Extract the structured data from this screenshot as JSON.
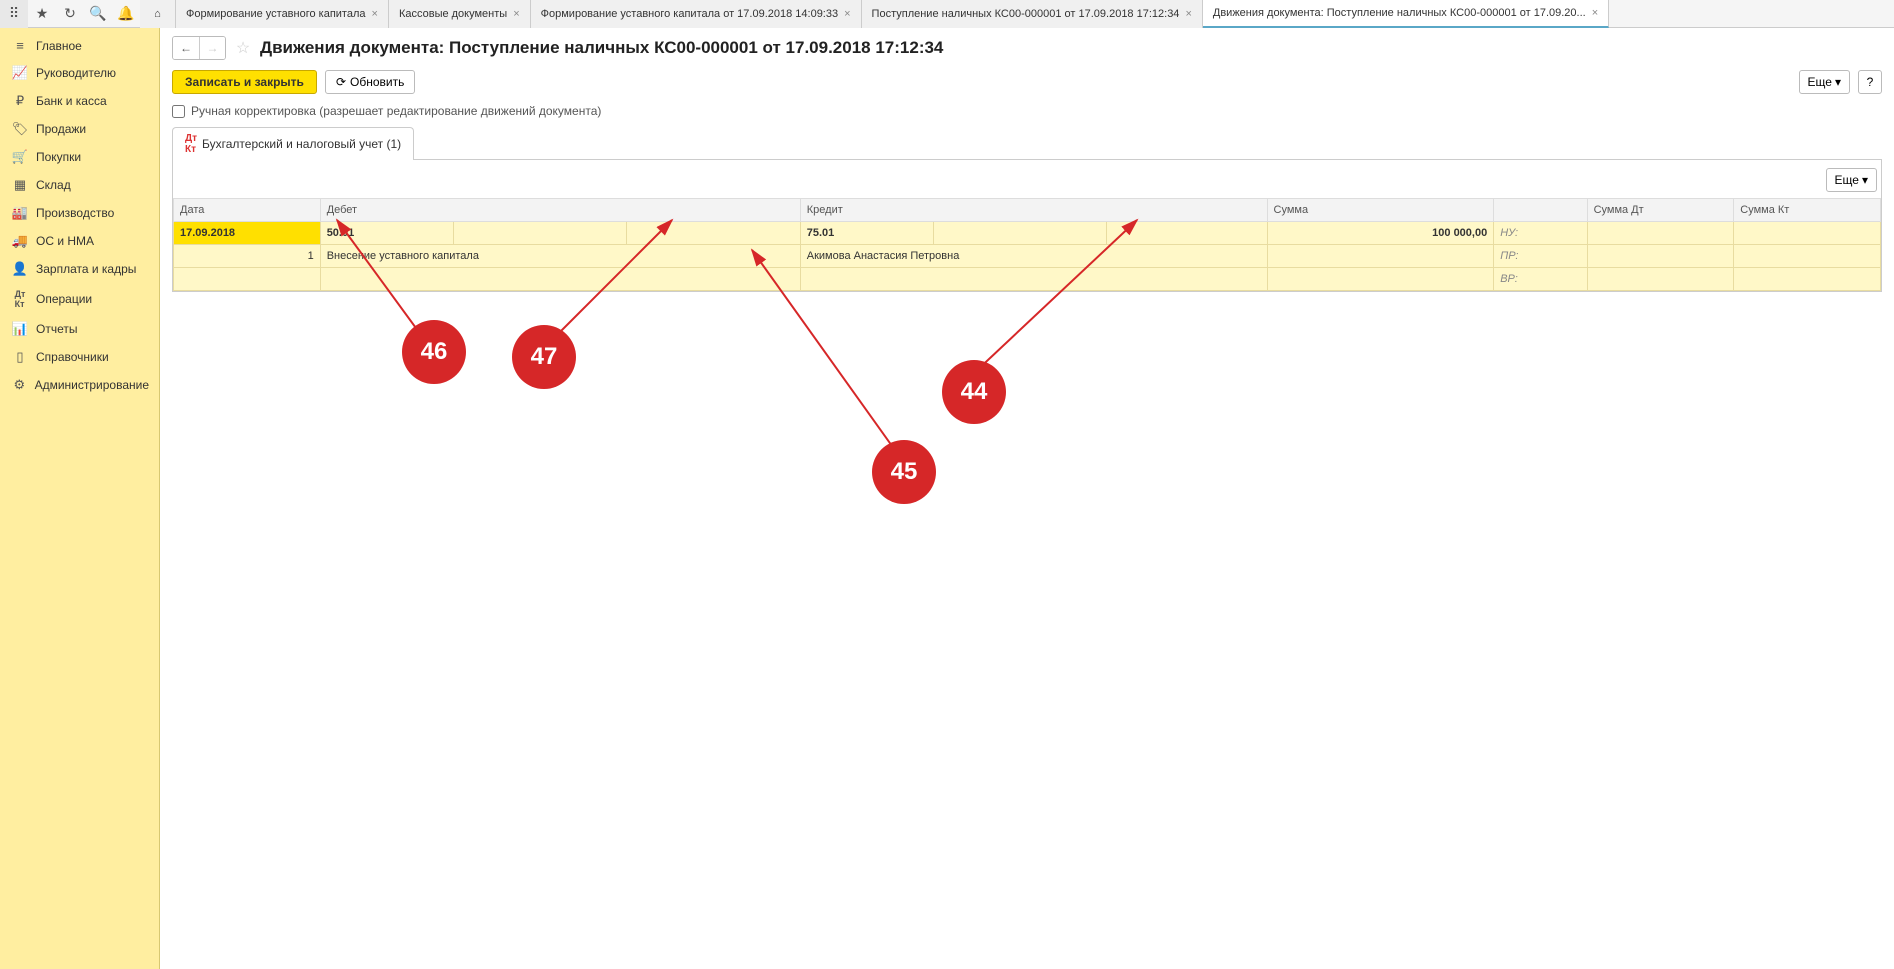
{
  "toolbar": {
    "tabs": [
      {
        "label": "Формирование уставного капитала"
      },
      {
        "label": "Кассовые документы"
      },
      {
        "label": "Формирование уставного капитала от 17.09.2018 14:09:33"
      },
      {
        "label": "Поступление наличных КС00-000001 от 17.09.2018 17:12:34"
      },
      {
        "label": "Движения документа: Поступление наличных КС00-000001 от 17.09.20..."
      }
    ]
  },
  "sidebar": {
    "items": [
      {
        "label": "Главное"
      },
      {
        "label": "Руководителю"
      },
      {
        "label": "Банк и касса"
      },
      {
        "label": "Продажи"
      },
      {
        "label": "Покупки"
      },
      {
        "label": "Склад"
      },
      {
        "label": "Производство"
      },
      {
        "label": "ОС и НМА"
      },
      {
        "label": "Зарплата и кадры"
      },
      {
        "label": "Операции"
      },
      {
        "label": "Отчеты"
      },
      {
        "label": "Справочники"
      },
      {
        "label": "Администрирование"
      }
    ]
  },
  "header": {
    "title": "Движения документа: Поступление наличных КС00-000001 от 17.09.2018 17:12:34"
  },
  "actions": {
    "save_close": "Записать и закрыть",
    "refresh": "Обновить",
    "more": "Еще",
    "help": "?"
  },
  "checkbox": {
    "manual_label": "Ручная корректировка (разрешает редактирование движений документа)"
  },
  "inner_tabs": {
    "accounting": "Бухгалтерский и налоговый учет (1)"
  },
  "table": {
    "headers": {
      "date": "Дата",
      "debet": "Дебет",
      "kredit": "Кредит",
      "summa": "Сумма",
      "summa_dt": "Сумма Дт",
      "summa_kt": "Сумма Кт"
    },
    "row1": {
      "date": "17.09.2018",
      "num": "1",
      "debet_acc": "50.01",
      "debet_desc": "Внесение уставного капитала",
      "kredit_acc": "75.01",
      "kredit_desc": "Акимова Анастасия Петровна",
      "summa": "100 000,00",
      "nu": "НУ:",
      "pr": "ПР:",
      "vr": "ВР:"
    }
  },
  "markers": {
    "m44": "44",
    "m45": "45",
    "m46": "46",
    "m47": "47"
  }
}
